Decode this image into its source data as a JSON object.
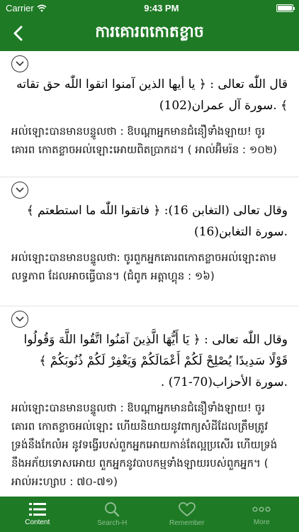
{
  "status": {
    "carrier": "Carrier",
    "time": "9:43 PM"
  },
  "nav": {
    "title": "ការគោរពកោតខ្លាច",
    "back_icon": "chevron-left-icon"
  },
  "colors": {
    "primary": "#1e7a25",
    "inactive_tab": "#8fbe92"
  },
  "items": [
    {
      "arabic": "قال اللّٰه تعالى : ﴿ يا أيها الذين آمنوا اتقوا اللّٰه حق تقاته ﴾ .سورة آل عمران(102)",
      "khmer": "អល់ឡោះបានមានបន្ទូលថា : ឱបណ្ដាអ្នកមានជំនឿទាំងឡាយ! ចូរគោរព កោតខ្លាចអល់ឡោះអោយពិតប្រាកដ។ ( អាល់អ៊ិមរ៉ន : ១០២)"
    },
    {
      "arabic": "وقال تعالى (التغابن 16): ﴿ فاتقوا اللّٰه ما استطعتم ﴾ .سورة التغابن(16)",
      "khmer": "អល់ឡោះបានមានបន្ទូលថា: ចូរពួកអ្នកគោរពកោតខ្លាចអល់ឡោះតាមលទ្ធភាព ដែលអាចធ្វើបាន។ (ជំពូក អត្តាហ្គុន : ១៦)"
    },
    {
      "arabic": "وقال اللّٰه تعالى : ﴿ يَا أَيُّهَا الَّذِينَ آمَنُوا اتَّقُوا اللَّهَ وَقُولُوا قَوْلًا سَدِيدًا يُصْلِحْ لَكُمْ أَعْمَالَكُمْ وَيَغْفِرْ لَكُمْ ذُنُوبَكُمْ ﴾ .سورة الأحزاب(70-71) .",
      "khmer": "អល់ឡោះបានមានបន្ទូលថា : ឱបណ្ដាអ្នកមានជំនឿទាំងឡាយ! ចូរគោរព កោតខ្លាចអល់ឡោះ ហើយនិយាយនូវពាក្យសំដីដែលត្រឹមត្រូវ ទ្រង់នឹងកែលំអ នូវទង្វើរបស់ពួកអ្នកអោយកាន់តែល្អប្រសើរ ហើយទ្រង់នឹងអភ័យទោសអោយ ពួកអ្នកនូវបាបកម្មទាំងឡាយរបស់ពួកអ្នក។ ( អាល់អះហ្សាប : ៧០-៧១)"
    }
  ],
  "tabs": [
    {
      "label": "Content",
      "icon": "list-icon"
    },
    {
      "label": "Search-H",
      "icon": "search-icon"
    },
    {
      "label": "Remember",
      "icon": "heart-icon"
    },
    {
      "label": "More",
      "icon": "more-dots-icon"
    }
  ]
}
